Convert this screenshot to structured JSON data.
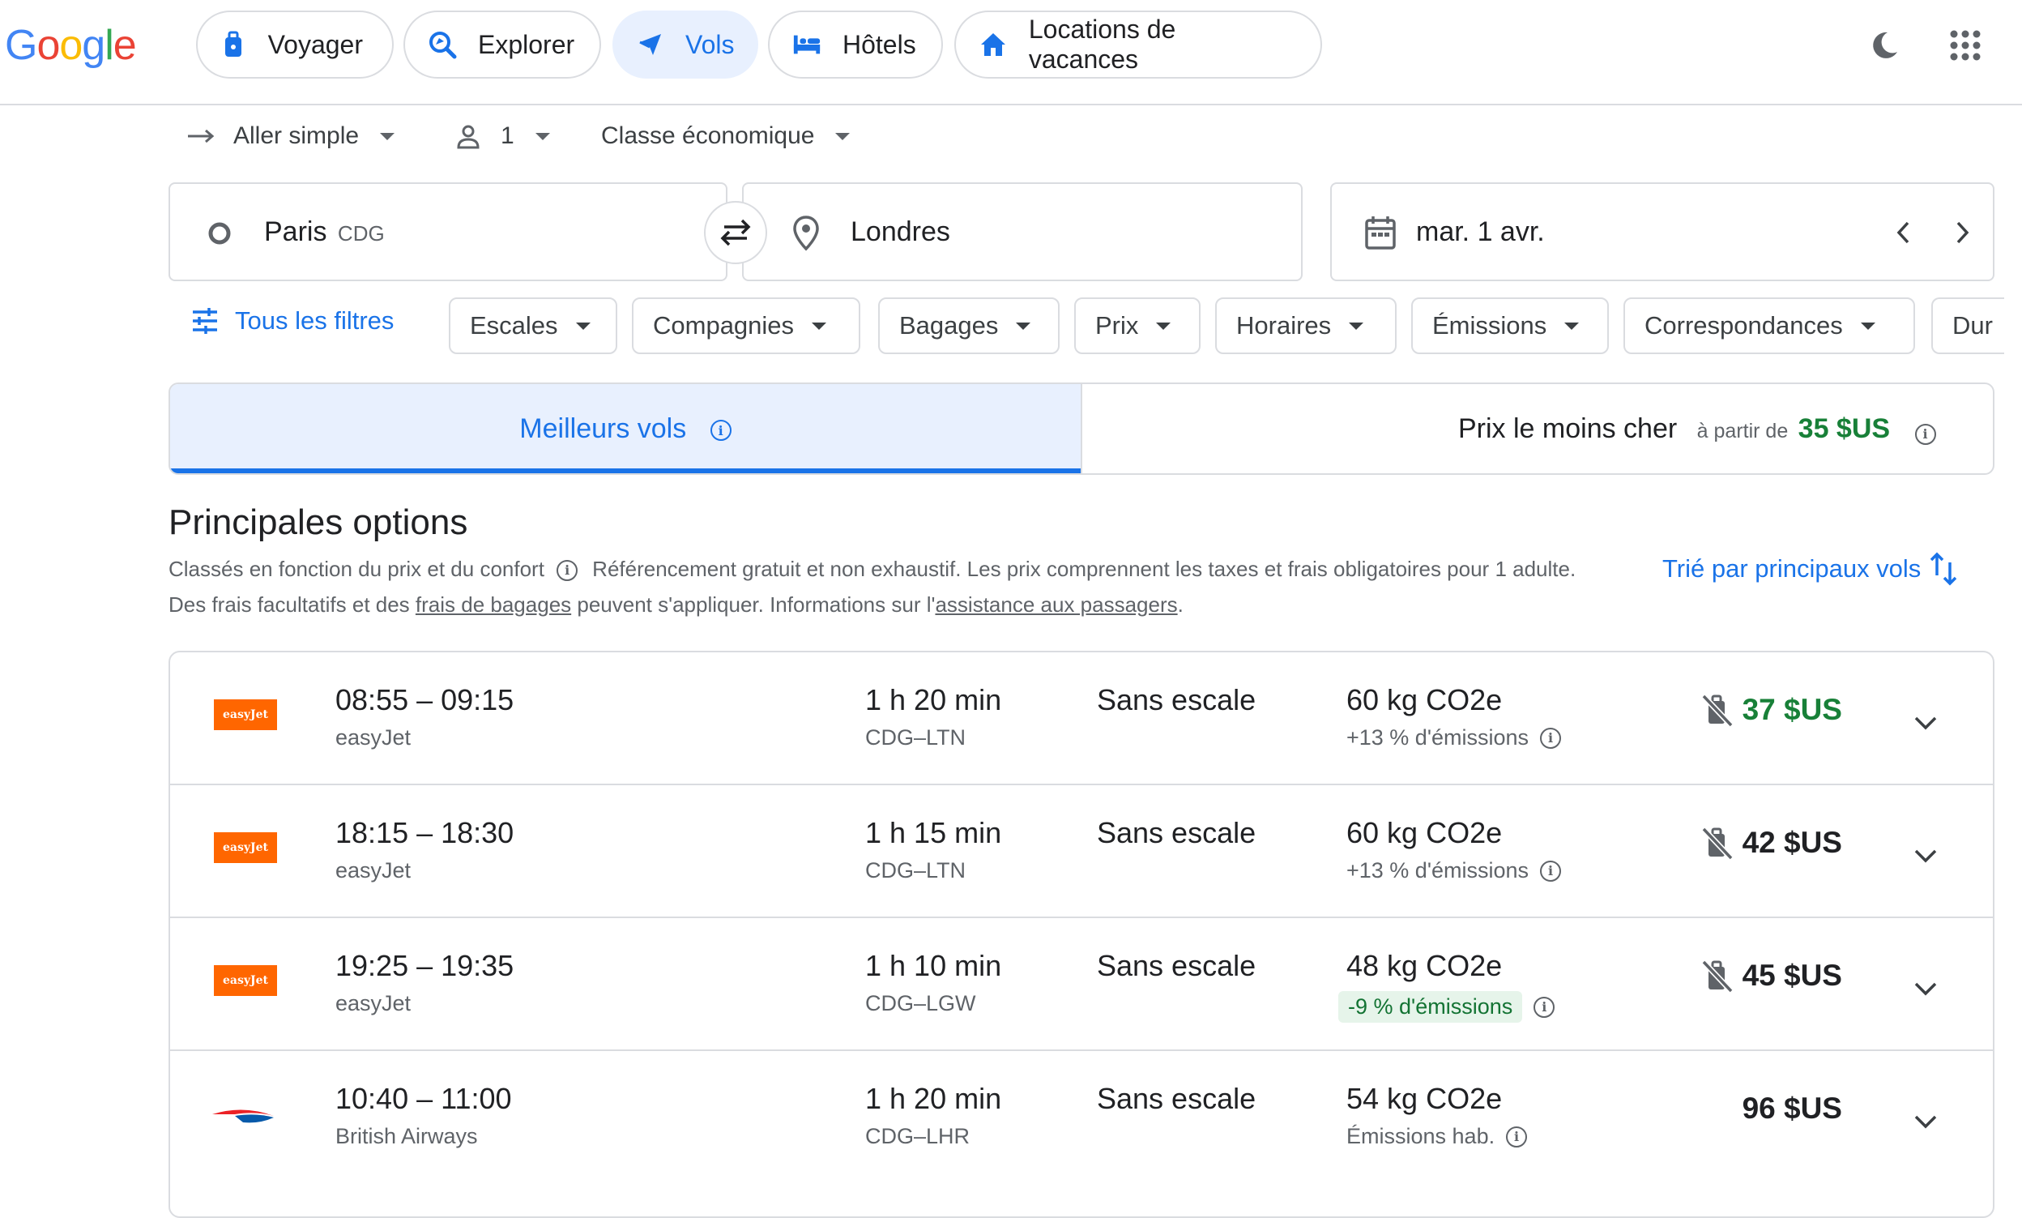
{
  "header": {
    "logo": "Google",
    "nav": [
      {
        "label": "Voyager",
        "icon": "travel-bag-icon"
      },
      {
        "label": "Explorer",
        "icon": "explore-icon"
      },
      {
        "label": "Vols",
        "icon": "plane-icon",
        "active": true
      },
      {
        "label": "Hôtels",
        "icon": "bed-icon"
      },
      {
        "label": "Locations de vacances",
        "icon": "house-icon"
      }
    ],
    "right_icons": [
      "dark-mode-icon",
      "apps-grid-icon"
    ]
  },
  "trip_options": {
    "trip_type": "Aller simple",
    "passengers": "1",
    "cabin": "Classe économique"
  },
  "search": {
    "origin_city": "Paris",
    "origin_code": "CDG",
    "destination": "Londres",
    "date": "mar. 1 avr."
  },
  "filters": {
    "all_filters": "Tous les filtres",
    "chips": [
      "Escales",
      "Compagnies",
      "Bagages",
      "Prix",
      "Horaires",
      "Émissions",
      "Correspondances",
      "Dur"
    ]
  },
  "tabs": {
    "best": "Meilleurs vols",
    "cheapest": "Prix le moins cher",
    "from_label": "à partir de",
    "cheapest_price": "35 $US"
  },
  "section": {
    "title": "Principales options",
    "ranked": "Classés en fonction du prix et du confort",
    "desc_part1": "Référencement gratuit et non exhaustif. Les prix comprennent les taxes et frais obligatoires pour 1 adulte. Des frais facultatifs et des ",
    "bag_fees_link": "frais de bagages",
    "desc_part2": " peuvent s'appliquer. Informations sur l'",
    "assistance_link": "assistance aux passagers",
    "desc_end": ".",
    "sort_label": "Trié par principaux vols"
  },
  "flights": [
    {
      "logo": "easyJet",
      "times": "08:55 – 09:15",
      "airline": "easyJet",
      "duration": "1 h 20 min",
      "route": "CDG–LTN",
      "stops": "Sans escale",
      "co2": "60 kg CO2e",
      "emissions": "+13 % d'émissions",
      "price": "37 $US",
      "no_bag": true
    },
    {
      "logo": "easyJet",
      "times": "18:15 – 18:30",
      "airline": "easyJet",
      "duration": "1 h 15 min",
      "route": "CDG–LTN",
      "stops": "Sans escale",
      "co2": "60 kg CO2e",
      "emissions": "+13 % d'émissions",
      "price": "42 $US",
      "no_bag": true
    },
    {
      "logo": "easyJet",
      "times": "19:25 – 19:35",
      "airline": "easyJet",
      "duration": "1 h 10 min",
      "route": "CDG–LGW",
      "stops": "Sans escale",
      "co2": "48 kg CO2e",
      "emissions": "-9 % d'émissions",
      "price": "45 $US",
      "no_bag": true
    },
    {
      "logo": "British Airways",
      "times": "10:40 – 11:00",
      "airline": "British Airways",
      "duration": "1 h 20 min",
      "route": "CDG–LHR",
      "stops": "Sans escale",
      "co2": "54 kg CO2e",
      "emissions": "Émissions hab.",
      "price": "96 $US",
      "no_bag": false
    }
  ],
  "colors": {
    "accent": "#1a73e8",
    "price_green": "#188038",
    "easyjet_orange": "#ff6600",
    "border": "#dadce0"
  }
}
